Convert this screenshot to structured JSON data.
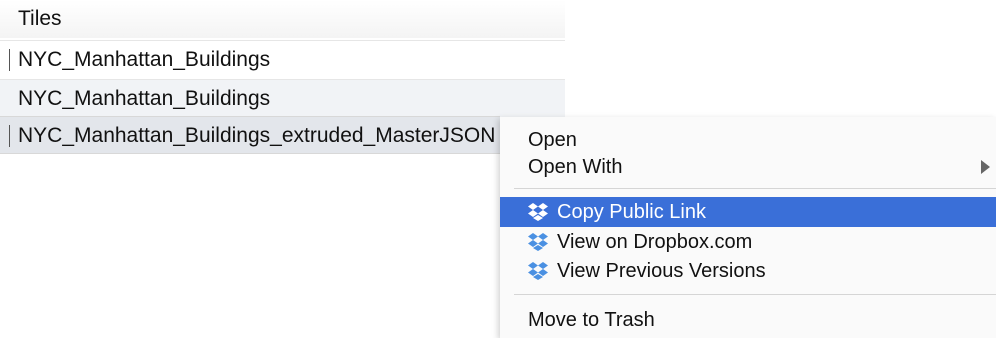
{
  "file_list": {
    "header": "Tiles",
    "rows": [
      {
        "name": "NYC_Manhattan_Buildings"
      },
      {
        "name": "NYC_Manhattan_Buildings"
      },
      {
        "name": "NYC_Manhattan_Buildings_extruded_MasterJSON"
      }
    ]
  },
  "context_menu": {
    "open": "Open",
    "open_with": "Open With",
    "copy_public_link": "Copy Public Link",
    "view_on_dropbox": "View on Dropbox.com",
    "view_previous_versions": "View Previous Versions",
    "move_to_trash": "Move to Trash"
  },
  "colors": {
    "highlight": "#3a6fd8",
    "dropbox_icon": "#4a90e2"
  },
  "icons": {
    "dropbox": "dropbox-icon",
    "submenu": "submenu-arrow-icon"
  }
}
